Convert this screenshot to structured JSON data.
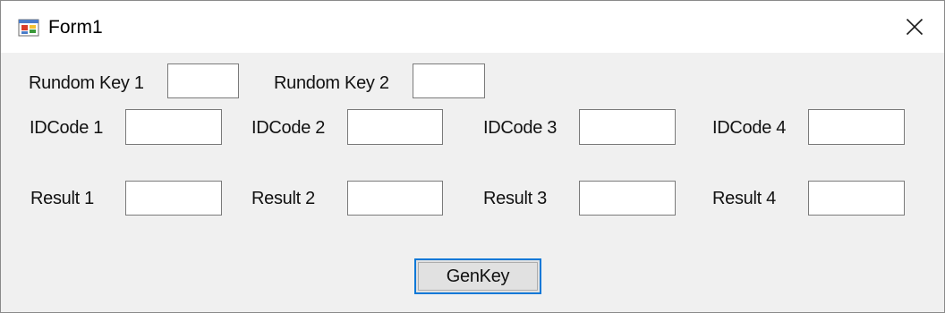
{
  "window": {
    "title": "Form1",
    "icon": "form-app-icon",
    "close_icon": "close-icon"
  },
  "random_keys": [
    {
      "label": "Rundom Key 1",
      "value": ""
    },
    {
      "label": "Rundom Key 2",
      "value": ""
    }
  ],
  "id_codes": [
    {
      "label": "IDCode 1",
      "value": ""
    },
    {
      "label": "IDCode 2",
      "value": ""
    },
    {
      "label": "IDCode 3",
      "value": ""
    },
    {
      "label": "IDCode 4",
      "value": ""
    }
  ],
  "results": [
    {
      "label": "Result 1",
      "value": ""
    },
    {
      "label": "Result 2",
      "value": ""
    },
    {
      "label": "Result 3",
      "value": ""
    },
    {
      "label": "Result 4",
      "value": ""
    }
  ],
  "genkey_button": {
    "label": "GenKey"
  },
  "colors": {
    "client_bg": "#f0f0f0",
    "titlebar_bg": "#ffffff",
    "button_focus_border": "#0a78d7"
  }
}
